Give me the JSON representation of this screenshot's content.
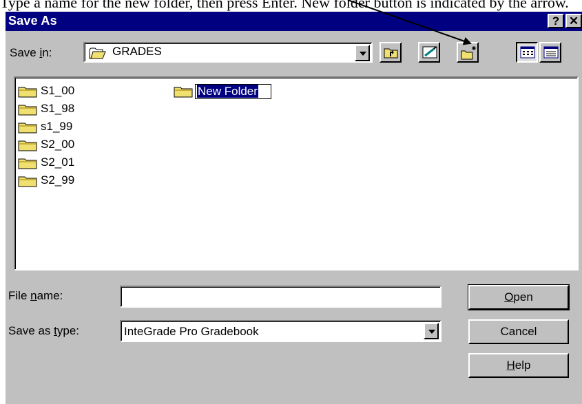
{
  "caption": "Type a name for the new folder, then press Enter. New folder button is indicated by the arrow.",
  "dialog": {
    "title": "Save As",
    "help_button": "?",
    "close_button": "✕",
    "save_in_label_pre": "Save ",
    "save_in_label_accel": "i",
    "save_in_label_post": "n:",
    "save_in_value": "GRADES",
    "toolbar": {
      "up_one_level_icon": "up-one-level-icon",
      "desktop_icon": "desktop-icon",
      "new_folder_icon": "new-folder-icon",
      "list_view_icon": "list-view-icon",
      "details_view_icon": "details-view-icon"
    },
    "folders": [
      "S1_00",
      "S1_98",
      "s1_99",
      "S2_00",
      "S2_01",
      "S2_99"
    ],
    "new_folder_edit": "New Folder",
    "file_name_label_pre": "File ",
    "file_name_label_accel": "n",
    "file_name_label_post": "ame:",
    "file_name_value": "",
    "save_type_label_pre": "Save as ",
    "save_type_label_accel": "t",
    "save_type_label_post": "ype:",
    "save_type_value": "InteGrade Pro Gradebook",
    "open_accel": "O",
    "open_rest": "pen",
    "cancel": "Cancel",
    "help_accel": "H",
    "help_rest": "elp"
  },
  "colors": {
    "titlebar": "#000080",
    "face": "#c0c0c0",
    "selection": "#000080",
    "folder": "#f0e070"
  }
}
